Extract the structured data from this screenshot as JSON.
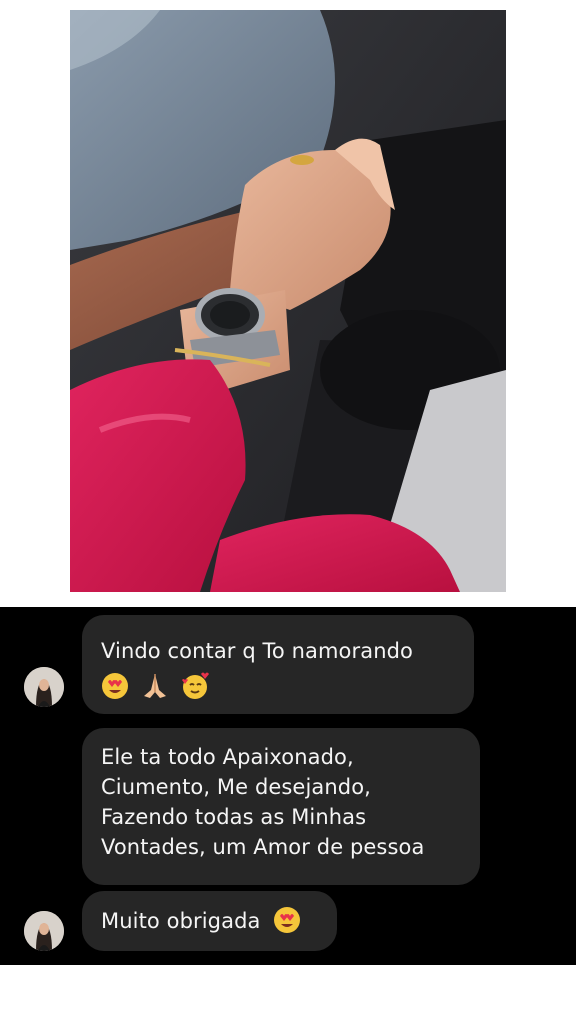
{
  "photo": {
    "description_icon": "photo-icon"
  },
  "chat": {
    "messages": [
      {
        "text": "Vindo contar q To namorando",
        "emojis": [
          "heart-eyes-emoji",
          "praying-hands-emoji",
          "smiling-hearts-emoji"
        ]
      },
      {
        "text": "Ele ta todo Apaixonado,\nCiumento, Me desejando,\nFazendo todas as Minhas\nVontades, um Amor de pessoa"
      },
      {
        "text": "Muito obrigada",
        "emojis": [
          "heart-eyes-emoji"
        ]
      }
    ],
    "colors": {
      "background": "#000000",
      "bubble": "#262626",
      "text": "#f5f5f5"
    }
  }
}
